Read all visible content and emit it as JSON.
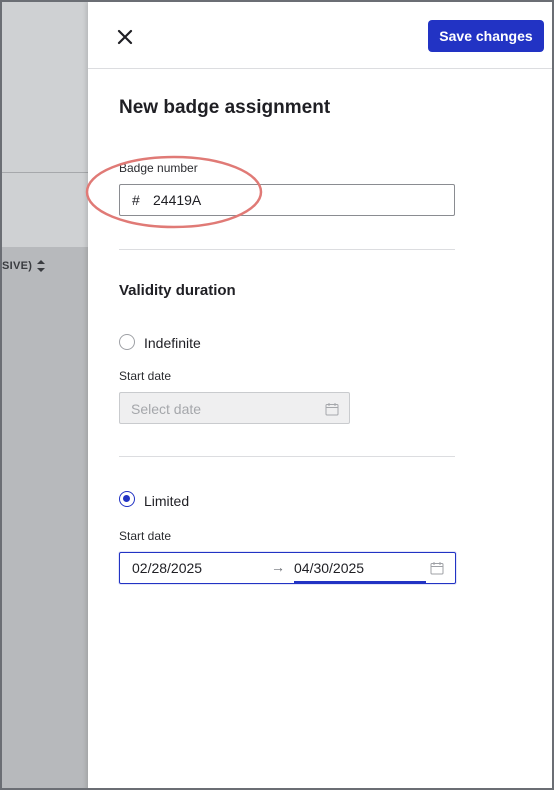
{
  "backdrop": {
    "column_header": "SIVE)"
  },
  "drawer": {
    "save_label": "Save changes",
    "title": "New badge assignment",
    "badge_number": {
      "label": "Badge number",
      "prefix": "#",
      "value": "24419A"
    },
    "validity": {
      "title": "Validity duration",
      "indefinite": {
        "label": "Indefinite",
        "selected": false,
        "start_date_label": "Start date",
        "start_date_placeholder": "Select date"
      },
      "limited": {
        "label": "Limited",
        "selected": true,
        "start_date_label": "Start date",
        "start_value": "02/28/2025",
        "end_value": "04/30/2025",
        "range_arrow": "→"
      }
    }
  },
  "colors": {
    "primary": "#2233c4",
    "annotation": "#e07a76",
    "backdrop": "#b7b9bc"
  },
  "icons": {
    "close": "close-icon",
    "calendar": "calendar-icon",
    "sort": "sort-icon"
  }
}
